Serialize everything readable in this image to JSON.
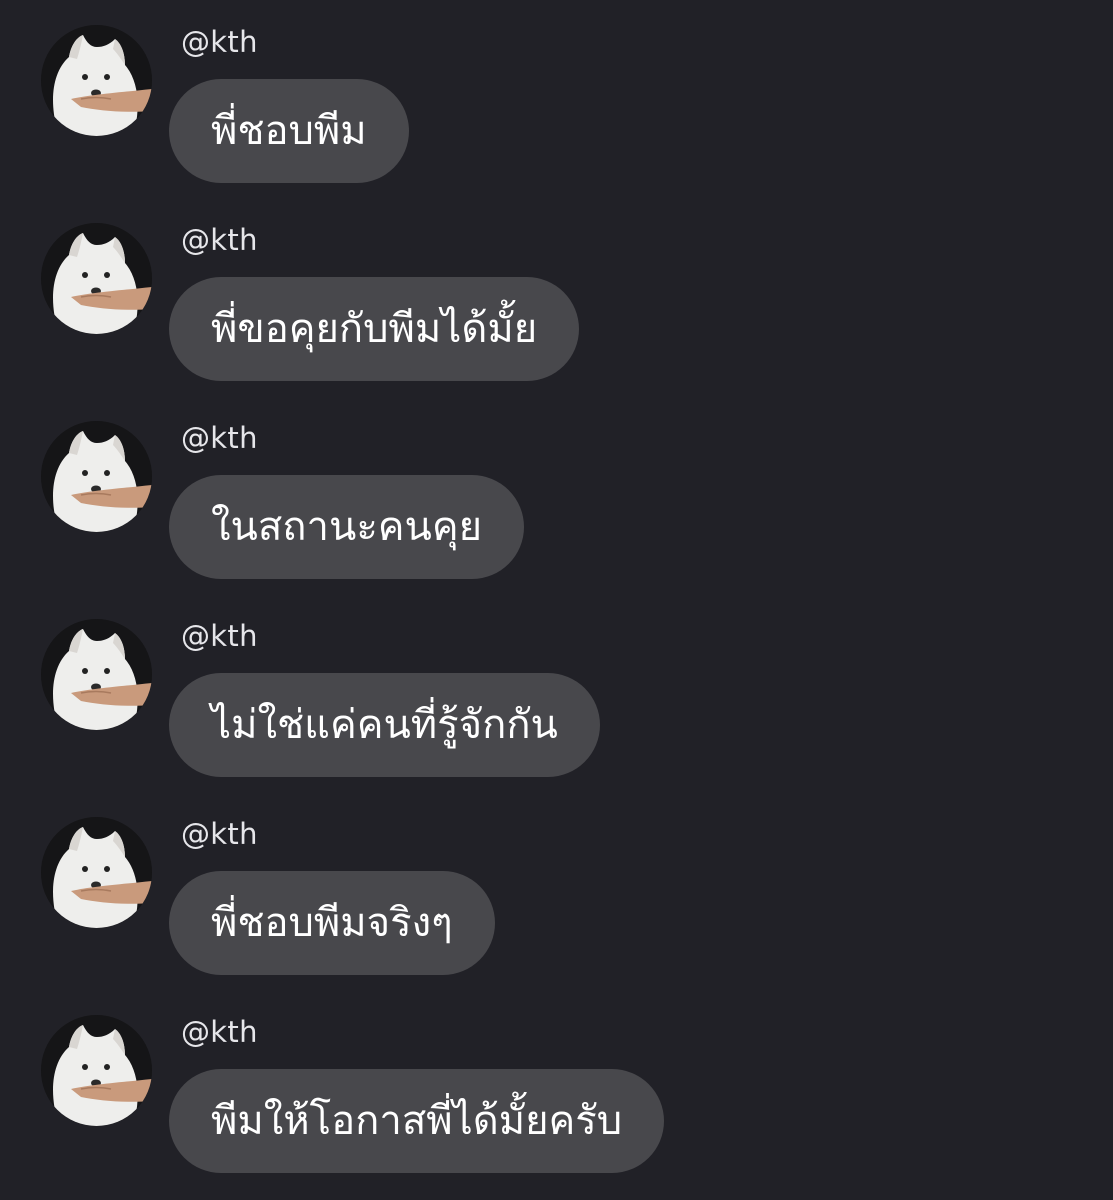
{
  "colors": {
    "background": "#212127",
    "bubble": "#48484c",
    "username": "#e6e6ea",
    "message_text": "#ffffff"
  },
  "messages": [
    {
      "avatar_icon": "white-samoyed-dog-avatar",
      "username": "@kth",
      "text": "พี่ชอบพีม"
    },
    {
      "avatar_icon": "white-samoyed-dog-avatar",
      "username": "@kth",
      "text": "พี่ขอคุยกับพีมได้มั้ย"
    },
    {
      "avatar_icon": "white-samoyed-dog-avatar",
      "username": "@kth",
      "text": "ในสถานะคนคุย"
    },
    {
      "avatar_icon": "white-samoyed-dog-avatar",
      "username": "@kth",
      "text": "ไม่ใช่แค่คนที่รู้จักกัน"
    },
    {
      "avatar_icon": "white-samoyed-dog-avatar",
      "username": "@kth",
      "text": "พี่ชอบพีมจริงๆ"
    },
    {
      "avatar_icon": "white-samoyed-dog-avatar",
      "username": "@kth",
      "text": "พีมให้โอกาสพี่ได้มั้ยครับ"
    }
  ]
}
